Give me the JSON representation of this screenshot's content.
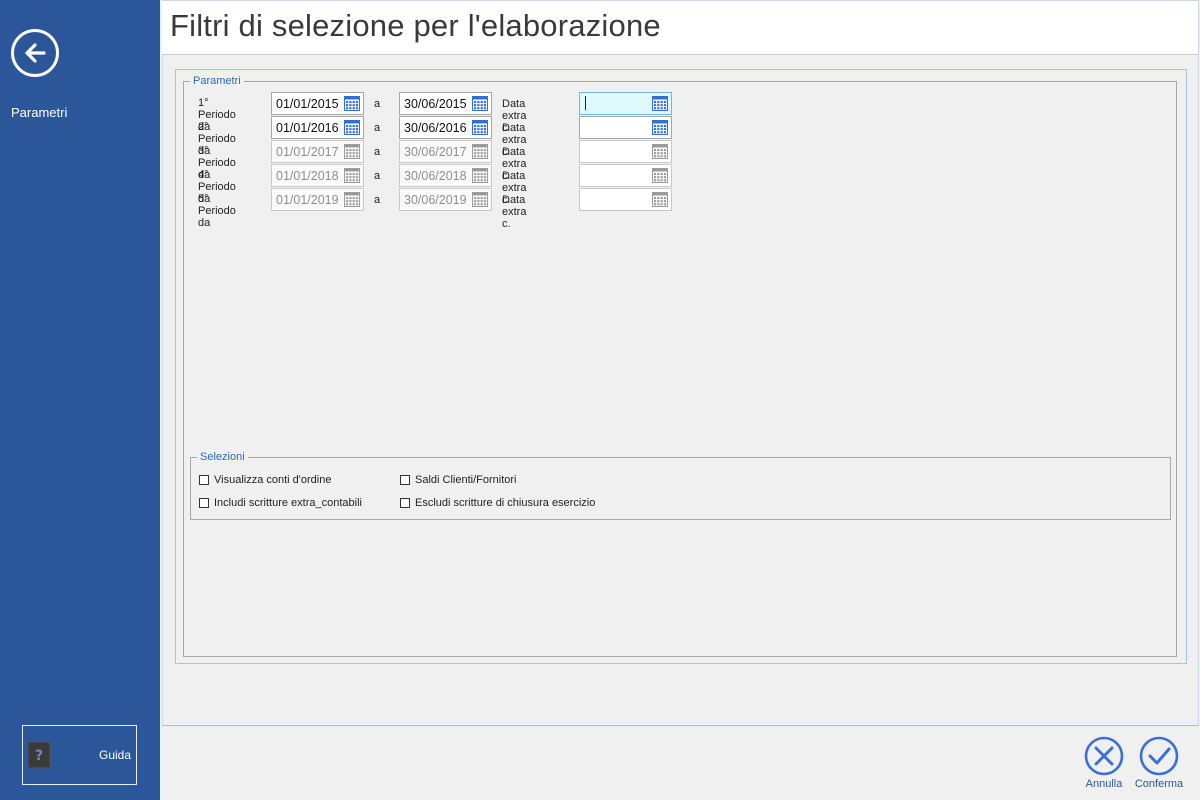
{
  "sidebar": {
    "back_icon": "arrow-left-circle-icon",
    "items": [
      {
        "label": "Parametri"
      }
    ],
    "guida_label": "Guida",
    "guida_icon": "help-book-icon",
    "bg_color": "#2b579a"
  },
  "header": {
    "title": "Filtri di selezione per l'elaborazione"
  },
  "parametri": {
    "legend": "Parametri",
    "separator": "a",
    "extra_label": "Data extra c.",
    "rows": [
      {
        "label": "1° Periodo da",
        "from": "01/01/2015",
        "to": "30/06/2015",
        "enabled": true
      },
      {
        "label": "2° Periodo da",
        "from": "01/01/2016",
        "to": "30/06/2016",
        "enabled": true
      },
      {
        "label": "3° Periodo da",
        "from": "01/01/2017",
        "to": "30/06/2017",
        "enabled": false
      },
      {
        "label": "4° Periodo da",
        "from": "01/01/2018",
        "to": "30/06/2018",
        "enabled": false
      },
      {
        "label": "5° Periodo da",
        "from": "01/01/2019",
        "to": "30/06/2019",
        "enabled": false
      }
    ]
  },
  "selezioni": {
    "legend": "Selezioni",
    "options": [
      {
        "label": "Visualizza conti d'ordine",
        "checked": false
      },
      {
        "label": "Saldi Clienti/Fornitori",
        "checked": false
      },
      {
        "label": "Includi scritture extra_contabili",
        "checked": false
      },
      {
        "label": "Escludi scritture di chiusura esercizio",
        "checked": false
      }
    ]
  },
  "actions": {
    "cancel_label": "Annulla",
    "confirm_label": "Conferma",
    "accent_color": "#3a6fd8"
  }
}
